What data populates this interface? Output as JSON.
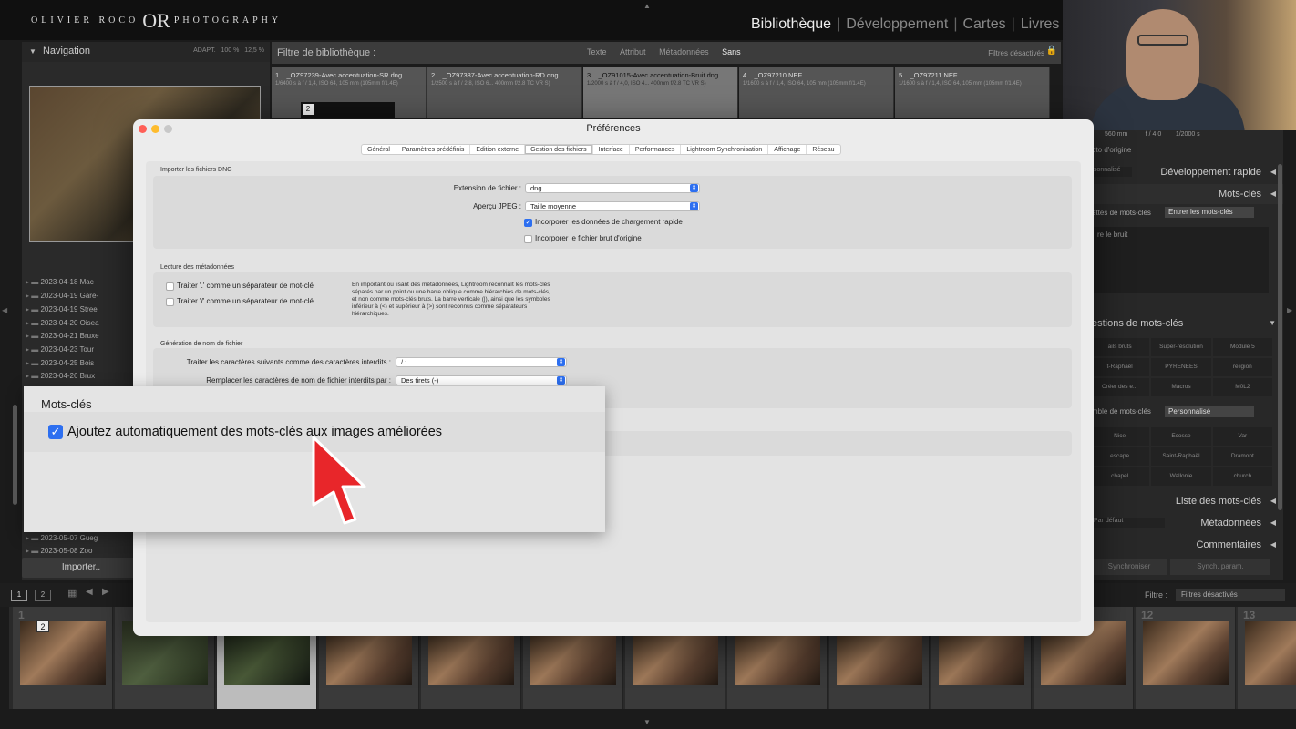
{
  "app": {
    "logo_left": "OLIVIER ROCO",
    "logo_mark": "OR",
    "logo_right": "PHOTOGRAPHY",
    "modules": [
      "Bibliothèque",
      "Développement",
      "Cartes",
      "Livres"
    ]
  },
  "navigator": {
    "title": "Navigation",
    "zoom_options": [
      "ADAPT.",
      "100 %",
      "12,5 %"
    ]
  },
  "folders": [
    "2023-04-18 Mac",
    "2023-04-19 Gare-",
    "2023-04-19 Stree",
    "2023-04-20 Oisea",
    "2023-04-21 Bruxe",
    "2023-04-23 Tour",
    "2023-04-25 Bois",
    "2023-04-26 Brux",
    "2023-05-07 Gueg",
    "2023-05-08 Zoo"
  ],
  "import_label": "Importer..",
  "library_filter": {
    "title": "Filtre de bibliothèque :",
    "tabs": [
      "Texte",
      "Attribut",
      "Métadonnées",
      "Sans"
    ],
    "state": "Filtres désactivés"
  },
  "grid_cells": [
    {
      "index": "1",
      "name": "_OZ97239-Avec accentuation-SR.dng",
      "meta": "1/6400 s à f / 1,4, ISO 64, 105 mm (105mm f/1.4E)"
    },
    {
      "index": "2",
      "name": "_OZ97387-Avec accentuation-RD.dng",
      "meta": "1/2500 s à f / 2,8, ISO 6... 400mm f/2.8 TC VR S)"
    },
    {
      "index": "3",
      "name": "_OZ91015-Avec accentuation-Bruit.dng",
      "meta": "1/2000 s à f / 4,0, ISO 4... 400mm f/2.8 TC VR S)"
    },
    {
      "index": "4",
      "name": "_OZ97210.NEF",
      "meta": "1/1600 s à f / 1,4, ISO 64, 105 mm (105mm f/1.4E)"
    },
    {
      "index": "5",
      "name": "_OZ97211.NEF",
      "meta": "1/1600 s à f / 1,4, ISO 64, 105 mm (105mm f/1.4E)"
    }
  ],
  "right_panel": {
    "histogram_info": [
      "560 mm",
      "f / 4,0",
      "1/2000 s"
    ],
    "original_photo": "oto d'origine",
    "quick_develop": "Développement rapide",
    "quick_develop_preset": "sonnalisé",
    "keywords": "Mots-clés",
    "keyword_tags_label": "ettes de mots-clés",
    "keyword_entry": "Entrer les mots-clés",
    "keyword_text": "re le bruit",
    "keyword_suggestions": "estions de mots-clés",
    "suggestions": [
      "ails bruts",
      "Super-résolution",
      "Module 5",
      "t-Raphaël",
      "PYRENEES",
      "religion",
      "Créer des e...",
      "Macros",
      "M0L2"
    ],
    "keyword_set_label": "mble de mots-clés",
    "keyword_set_value": "Personnalisé",
    "keyword_set": [
      "Nice",
      "Ecosse",
      "Var",
      "escape",
      "Saint-Raphaël",
      "Dramont",
      "chapel",
      "Wallonie",
      "church"
    ],
    "keyword_list": "Liste des mots-clés",
    "metadata": "Métadonnées",
    "metadata_preset": "Par défaut",
    "comments": "Commentaires",
    "sync": "Synchroniser",
    "sync_settings": "Synch. param."
  },
  "toolbar": {
    "view_1": "1",
    "view_2": "2",
    "filter_label": "Filtre :",
    "filter_value": "Filtres désactivés"
  },
  "filmstrip": {
    "numbers": [
      "1",
      "",
      "",
      "",
      "",
      "",
      "",
      "",
      "",
      "",
      "",
      "12",
      "13"
    ],
    "badges": [
      "2",
      "2",
      "2"
    ]
  },
  "grid_badge": "2",
  "preferences": {
    "title": "Préférences",
    "tabs": [
      "Général",
      "Paramètres prédéfinis",
      "Edition externe",
      "Gestion des fichiers",
      "Interface",
      "Performances",
      "Lightroom Synchronisation",
      "Affichage",
      "Réseau"
    ],
    "selected_tab": "Gestion des fichiers",
    "dng": {
      "title": "Importer les fichiers DNG",
      "extension_label": "Extension de fichier :",
      "extension_value": "dng",
      "jpeg_label": "Aperçu JPEG :",
      "jpeg_value": "Taille moyenne",
      "fast_load": "Incorporer les données de chargement rapide",
      "fast_load_checked": true,
      "embed_raw": "Incorporer le fichier brut d'origine",
      "embed_raw_checked": false
    },
    "metadata_reading": {
      "title": "Lecture des métadonnées",
      "dot_sep": "Traiter '.' comme un séparateur de mot-clé",
      "slash_sep": "Traiter '/' comme un séparateur de mot-clé",
      "note": "En important ou lisant des métadonnées, Lightroom reconnaît les mots-clés séparés par un point ou une barre oblique comme hiérarchies de mots-clés, et non comme mots-clés bruts. La barre verticale (|), ainsi que les symboles inférieur à (<) et supérieur à (>) sont reconnus comme séparateurs hiérarchiques."
    },
    "filename": {
      "title": "Génération de nom de fichier",
      "illegal_label": "Traiter les caractères suivants comme des caractères interdits :",
      "illegal_value": "/ :",
      "replace_label": "Remplacer les caractères de nom de fichier interdits par :",
      "replace_value": "Des tirets (-)"
    }
  },
  "callout": {
    "title": "Mots-clés",
    "checkbox_label": "Ajoutez automatiquement des mots-clés aux images améliorées",
    "checked": true
  },
  "colors": {
    "accent": "#2d6ff0",
    "cursor": "#e8262a"
  }
}
